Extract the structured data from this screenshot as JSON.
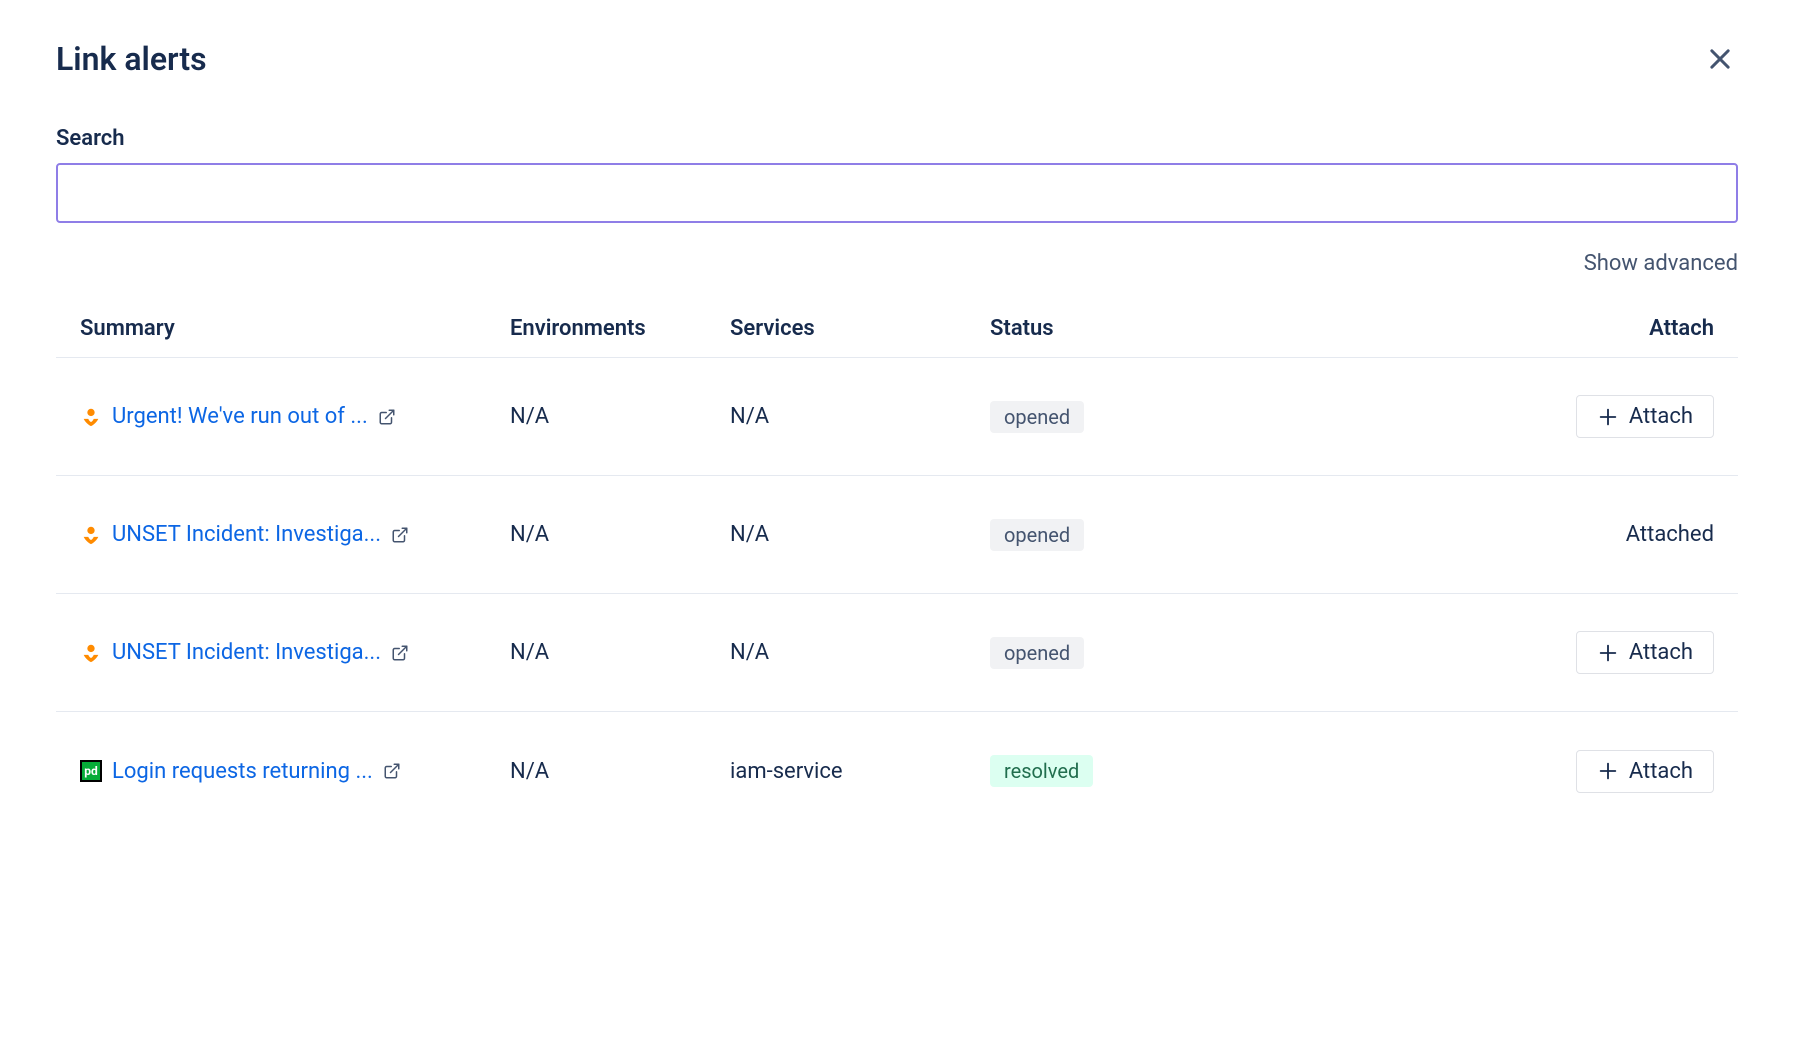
{
  "header": {
    "title": "Link alerts"
  },
  "search": {
    "label": "Search",
    "value": ""
  },
  "advanced_link": "Show advanced",
  "columns": {
    "summary": "Summary",
    "environments": "Environments",
    "services": "Services",
    "status": "Status",
    "attach": "Attach"
  },
  "attach_button_label": "Attach",
  "attached_text": "Attached",
  "rows": [
    {
      "icon_type": "opsgenie",
      "summary": "Urgent! We've run out of ...",
      "environments": "N/A",
      "services": "N/A",
      "status": "opened",
      "status_class": "opened",
      "attached": false
    },
    {
      "icon_type": "opsgenie",
      "summary": "UNSET Incident: Investiga...",
      "environments": "N/A",
      "services": "N/A",
      "status": "opened",
      "status_class": "opened",
      "attached": true
    },
    {
      "icon_type": "opsgenie",
      "summary": "UNSET Incident: Investiga...",
      "environments": "N/A",
      "services": "N/A",
      "status": "opened",
      "status_class": "opened",
      "attached": false
    },
    {
      "icon_type": "pagerduty",
      "summary": "Login requests returning ...",
      "environments": "N/A",
      "services": "iam-service",
      "status": "resolved",
      "status_class": "resolved",
      "attached": false
    }
  ]
}
